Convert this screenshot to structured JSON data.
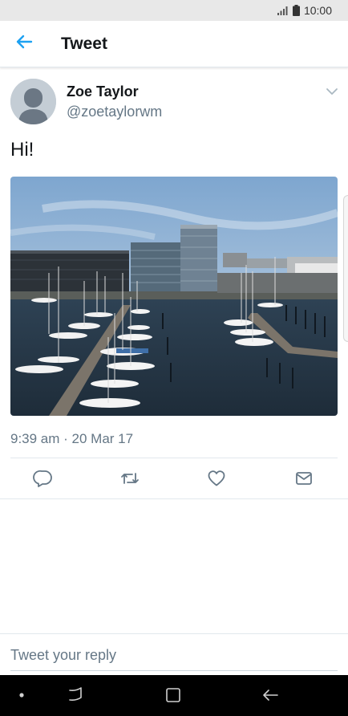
{
  "status_bar": {
    "time": "10:00",
    "signal_icon": "signal-icon",
    "battery_icon": "battery-icon"
  },
  "header": {
    "title": "Tweet",
    "back_icon": "arrow-left-icon",
    "accent_color": "#1da1f2"
  },
  "tweet": {
    "author_name": "Zoe Taylor",
    "author_handle": "@zoetaylorwm",
    "text": "Hi!",
    "image": "marina-harbor-photo",
    "timestamp": "9:39 am · 20 Mar 17",
    "menu_icon": "chevron-down-icon"
  },
  "actions": [
    {
      "name": "reply",
      "icon": "reply-icon"
    },
    {
      "name": "retweet",
      "icon": "retweet-icon"
    },
    {
      "name": "like",
      "icon": "heart-icon"
    },
    {
      "name": "direct-message",
      "icon": "mail-icon"
    }
  ],
  "reply": {
    "placeholder": "Tweet your reply"
  },
  "nav_bar": {
    "items": [
      "dot-icon",
      "recents-icon",
      "home-icon",
      "back-icon"
    ]
  },
  "colors": {
    "text_primary": "#14171a",
    "text_secondary": "#657786",
    "icon_gray": "#657786",
    "divider": "#e1e8ed"
  }
}
